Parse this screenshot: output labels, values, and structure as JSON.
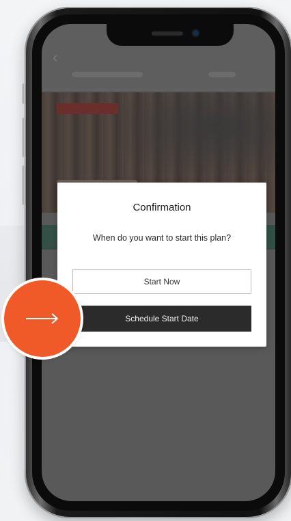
{
  "modal": {
    "title": "Confirmation",
    "question": "When do you want to start this plan?",
    "start_now_label": "Start Now",
    "schedule_label": "Schedule Start Date"
  },
  "colors": {
    "accent": "#f05a28",
    "primary_button": "#2b2b2b",
    "overlay_hero_strip": "#335046"
  },
  "icons": {
    "callout": "arrow-right-icon",
    "back": "chevron-left-icon"
  }
}
